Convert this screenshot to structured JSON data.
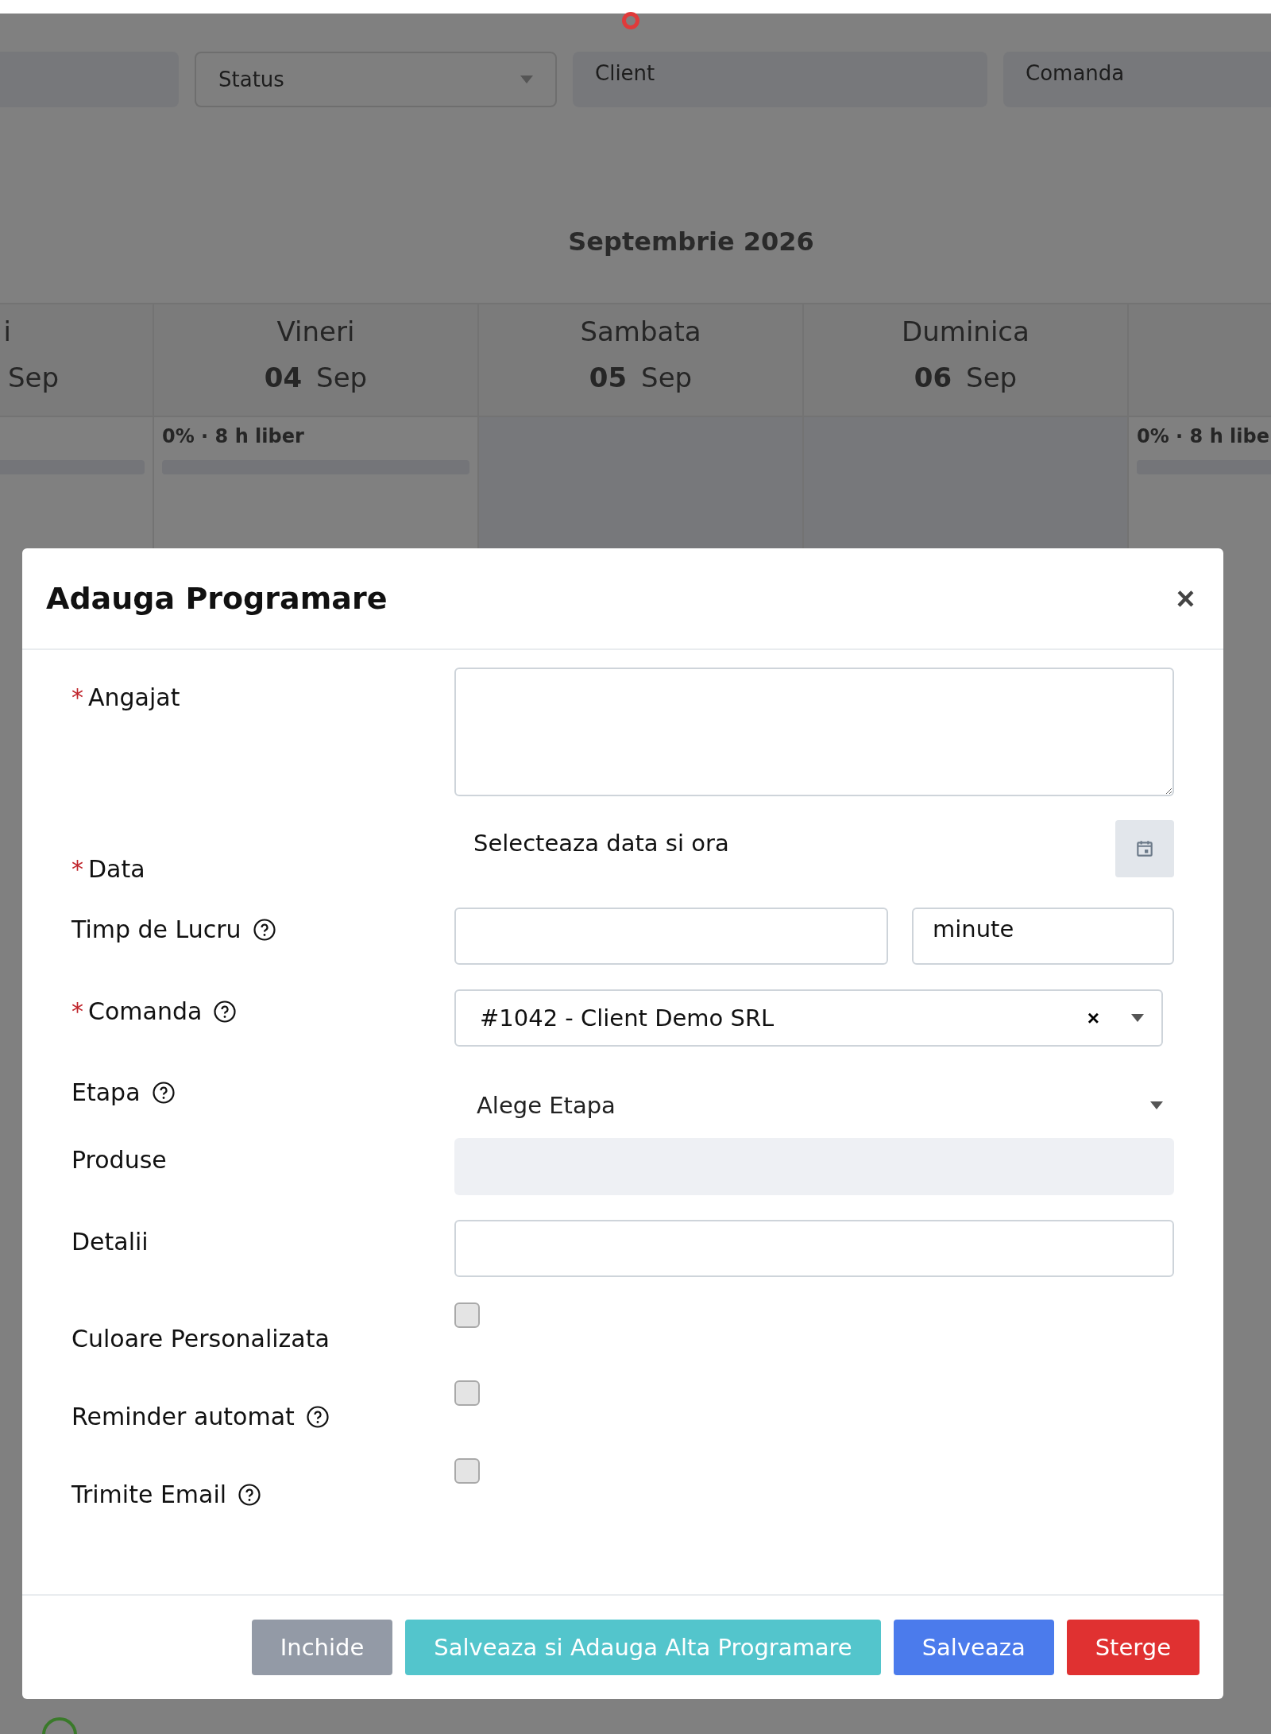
{
  "filters": [
    {
      "kind": "blank"
    },
    {
      "kind": "select",
      "value": "Status"
    },
    {
      "kind": "label",
      "label": "Client"
    },
    {
      "kind": "label",
      "label": "Comanda"
    }
  ],
  "calendar": {
    "title": "Septembrie 2026",
    "days": [
      {
        "name": "i",
        "month": "Sep"
      },
      {
        "name": "Vineri",
        "number": "04",
        "month": "Sep"
      },
      {
        "name": "Sambata",
        "number": "05",
        "month": "Sep"
      },
      {
        "name": "Duminica",
        "number": "06",
        "month": "Sep"
      }
    ],
    "cells": [
      {
        "kind": "load",
        "level": 0
      },
      {
        "kind": "load",
        "text": "0% · 8 h liber",
        "level": 0
      },
      {
        "kind": "free"
      },
      {
        "kind": "free"
      },
      {
        "kind": "load",
        "text": "0% · 8 h libe",
        "level": 0
      }
    ]
  },
  "modal": {
    "title": "Adauga Programare",
    "close": "×",
    "fields": [
      {
        "kind": "textarea",
        "required_mark": "*",
        "label": "Angajat"
      },
      {
        "kind": "date",
        "required_mark": "*",
        "label": "Data",
        "placeholder": "Selecteaza data si ora"
      },
      {
        "kind": "duration",
        "label": "Timp de Lucru",
        "help": true,
        "unit": "minute"
      },
      {
        "kind": "select",
        "required_mark": "*",
        "label": "Comanda",
        "help": true,
        "value": "#1042 - Client Demo SRL",
        "clear": "×"
      },
      {
        "kind": "plainselect",
        "label": "Etapa",
        "help": true,
        "value": "Alege Etapa"
      },
      {
        "kind": "readonly",
        "label": "Produse"
      },
      {
        "kind": "text",
        "label": "Detalii"
      },
      {
        "kind": "checkbox",
        "label": "Culoare Personalizata",
        "checked": false
      },
      {
        "kind": "checkbox",
        "label": "Reminder automat",
        "help": true,
        "checked": false
      },
      {
        "kind": "checkbox",
        "label": "Trimite Email",
        "help": true,
        "checked": false
      }
    ],
    "buttons": [
      {
        "label": "Inchide",
        "kind": "secondary"
      },
      {
        "label": "Salveaza si Adauga Alta Programare",
        "kind": "info"
      },
      {
        "label": "Salveaza",
        "kind": "primary"
      },
      {
        "label": "Sterge",
        "kind": "danger"
      }
    ]
  }
}
